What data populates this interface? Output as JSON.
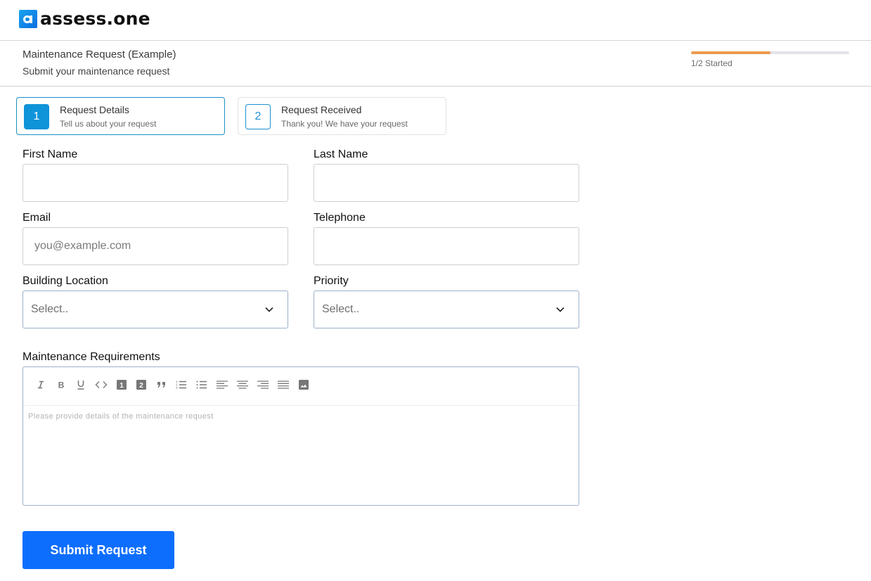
{
  "brand": {
    "name": "assess.one",
    "logo_icon": "assess-one-logo-icon",
    "accent": "#0f93d9"
  },
  "header": {
    "title": "Maintenance Request (Example)",
    "subtitle": "Submit your maintenance request",
    "progress": {
      "value": 0.5,
      "label": "1/2 Started",
      "color": "#eb9b4f"
    }
  },
  "steps": [
    {
      "number": "1",
      "title": "Request Details",
      "description": "Tell us about your request",
      "active": true
    },
    {
      "number": "2",
      "title": "Request Received",
      "description": "Thank you! We have your request",
      "active": false
    }
  ],
  "form": {
    "first_name": {
      "label": "First Name",
      "value": "",
      "placeholder": ""
    },
    "last_name": {
      "label": "Last Name",
      "value": "",
      "placeholder": ""
    },
    "email": {
      "label": "Email",
      "value": "",
      "placeholder": "you@example.com"
    },
    "telephone": {
      "label": "Telephone",
      "value": "",
      "placeholder": ""
    },
    "building_location": {
      "label": "Building Location",
      "selected": "Select..",
      "icon": "chevron-down-icon"
    },
    "priority": {
      "label": "Priority",
      "selected": "Select..",
      "icon": "chevron-down-icon"
    },
    "maintenance_requirements": {
      "label": "Maintenance Requirements",
      "placeholder": "Please provide details of the maintenance request",
      "toolbar": [
        "italic",
        "bold",
        "underline",
        "code",
        "heading-1",
        "heading-2",
        "blockquote",
        "ordered-list",
        "unordered-list",
        "align-left",
        "align-center",
        "align-right",
        "align-justify",
        "image"
      ]
    },
    "submit_label": "Submit Request",
    "submit_color": "#0d6efd"
  }
}
